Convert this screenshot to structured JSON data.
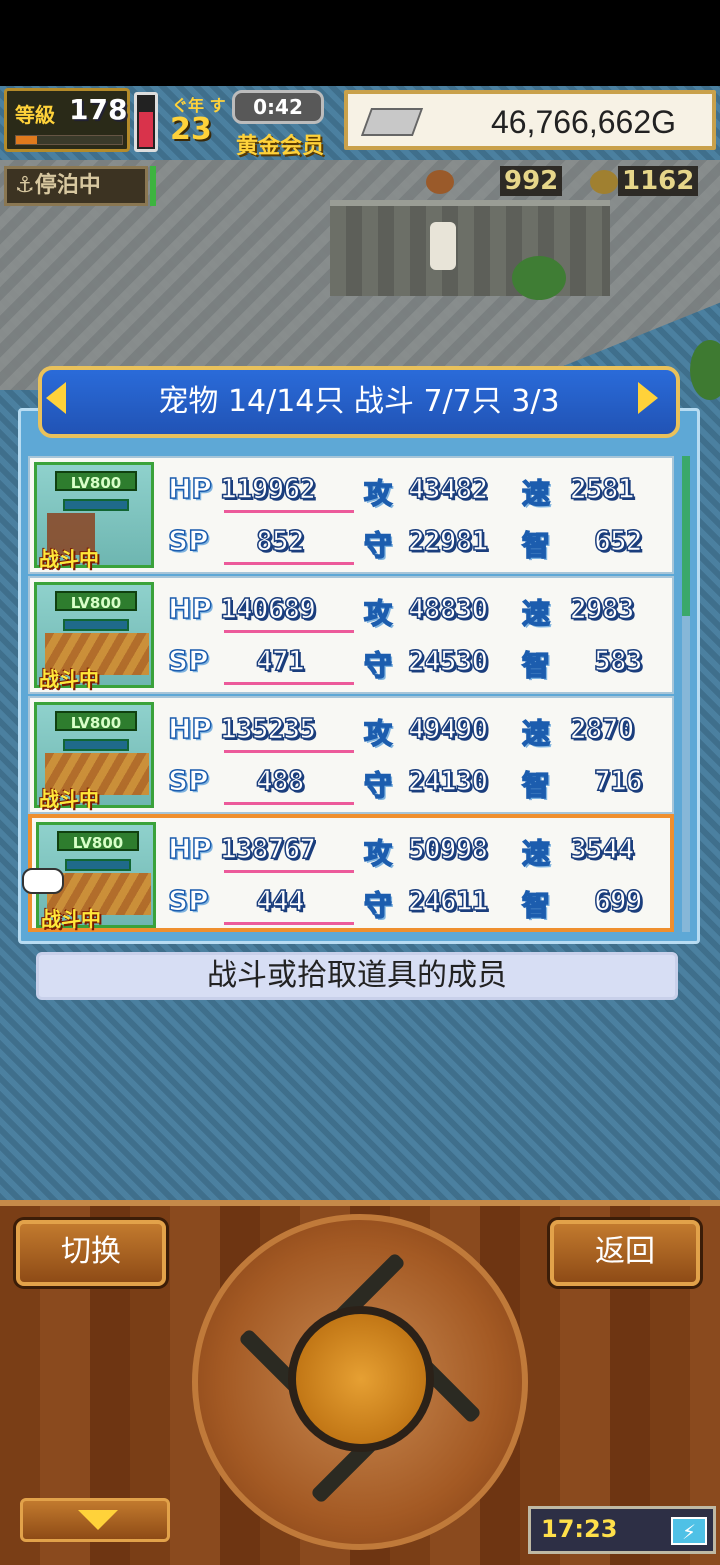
{
  "hud": {
    "level_label": "等級",
    "level": "178",
    "level_progress": 0.2,
    "gauge_fill": 0.7,
    "day_label": "ぐ年 す",
    "day": "23",
    "timer": "0:42",
    "membership": "黄金会员",
    "money": "46,766,662G",
    "docking_status": "⚓停泊中",
    "food": "992",
    "coins": "1162"
  },
  "panel": {
    "header": "宠物 14/14只 战斗 7/7只 3/3",
    "hint": "战斗或拾取道具的成员"
  },
  "labels": {
    "hp": "HP",
    "sp": "SP",
    "atk": "攻",
    "def": "守",
    "spd": "速",
    "int": "智"
  },
  "pets": [
    {
      "lv": "LV800",
      "status": "战斗中",
      "hp": "119962",
      "sp": "852",
      "atk": "43482",
      "def": "22981",
      "spd": "2581",
      "int": "652"
    },
    {
      "lv": "LV800",
      "status": "战斗中",
      "hp": "140689",
      "sp": "471",
      "atk": "48830",
      "def": "24530",
      "spd": "2983",
      "int": "583"
    },
    {
      "lv": "LV800",
      "status": "战斗中",
      "hp": "135235",
      "sp": "488",
      "atk": "49490",
      "def": "24130",
      "spd": "2870",
      "int": "716"
    },
    {
      "lv": "LV800",
      "status": "战斗中",
      "hp": "138767",
      "sp": "444",
      "atk": "50998",
      "def": "24611",
      "spd": "3544",
      "int": "699"
    }
  ],
  "controls": {
    "switch": "切换",
    "back": "返回"
  },
  "clock": {
    "time": "17:23",
    "bolt": "⚡"
  },
  "colors": {
    "header_blue": "#2a6bd9",
    "selected_border": "#ef8f2e",
    "gold": "#ffd23a"
  }
}
